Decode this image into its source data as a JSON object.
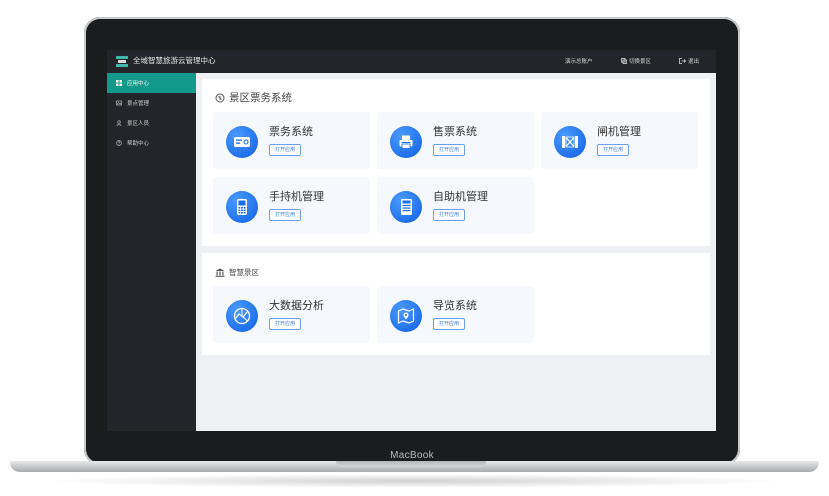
{
  "device": {
    "brand_label": "MacBook"
  },
  "header": {
    "title": "全域智慧旅游云管理中心",
    "account_label": "演示总账户",
    "switch_label": "切换景区",
    "logout_label": "退出"
  },
  "sidebar": {
    "items": [
      {
        "label": "应用中心",
        "icon": "grid-icon",
        "active": true
      },
      {
        "label": "景点管理",
        "icon": "scenic-icon",
        "active": false
      },
      {
        "label": "景区人员",
        "icon": "person-icon",
        "active": false
      },
      {
        "label": "帮助中心",
        "icon": "help-icon",
        "active": false
      }
    ]
  },
  "sections": [
    {
      "title": "景区票务系统",
      "icon": "ticket-circle-icon",
      "cards": [
        {
          "name": "票务系统",
          "button": "打开应用",
          "icon": "ticket-icon"
        },
        {
          "name": "售票系统",
          "button": "打开应用",
          "icon": "printer-icon"
        },
        {
          "name": "闸机管理",
          "button": "打开应用",
          "icon": "gate-icon"
        },
        {
          "name": "手持机管理",
          "button": "打开应用",
          "icon": "handheld-icon"
        },
        {
          "name": "自助机管理",
          "button": "打开应用",
          "icon": "kiosk-icon"
        }
      ]
    },
    {
      "title": "智慧景区",
      "icon": "bank-icon",
      "cards": [
        {
          "name": "大数据分析",
          "button": "打开应用",
          "icon": "chart-icon"
        },
        {
          "name": "导览系统",
          "button": "打开应用",
          "icon": "map-pin-icon"
        }
      ]
    }
  ],
  "colors": {
    "accent": "#13998c",
    "sidebar_bg": "#23252b",
    "icon_blue": "#1a6cf0"
  }
}
